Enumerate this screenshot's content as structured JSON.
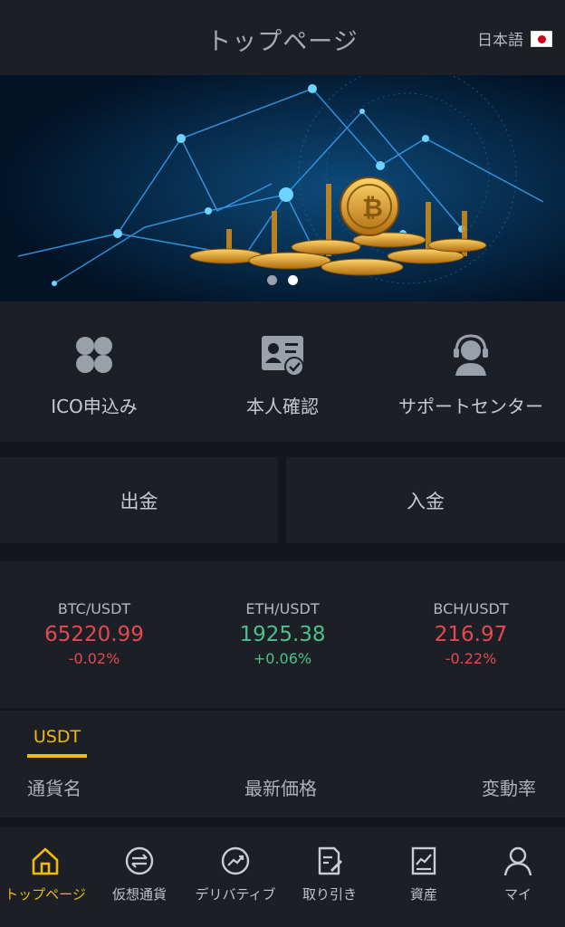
{
  "header": {
    "title": "トップページ",
    "language": "日本語",
    "flag_icon": "japan-flag-icon"
  },
  "banner": {
    "slide_count": 2,
    "active_slide": 2
  },
  "quick_actions": [
    {
      "label": "ICO申込み",
      "icon": "clover-icon"
    },
    {
      "label": "本人確認",
      "icon": "id-card-check-icon"
    },
    {
      "label": "サポートセンター",
      "icon": "headset-agent-icon"
    }
  ],
  "funds": {
    "withdraw_label": "出金",
    "deposit_label": "入金"
  },
  "tickers": [
    {
      "pair": "BTC/USDT",
      "price": "65220.99",
      "change": "-0.02%",
      "direction": "down"
    },
    {
      "pair": "ETH/USDT",
      "price": "1925.38",
      "change": "+0.06%",
      "direction": "up"
    },
    {
      "pair": "BCH/USDT",
      "price": "216.97",
      "change": "-0.22%",
      "direction": "down"
    }
  ],
  "market": {
    "active_tab": "USDT",
    "columns": {
      "name": "通貨名",
      "price": "最新価格",
      "change": "変動率"
    }
  },
  "bottom_nav": [
    {
      "label": "トップページ",
      "icon": "home-icon",
      "active": true
    },
    {
      "label": "仮想通貨",
      "icon": "exchange-arrows-icon",
      "active": false
    },
    {
      "label": "デリバティブ",
      "icon": "trend-chart-icon",
      "active": false
    },
    {
      "label": "取り引き",
      "icon": "document-edit-icon",
      "active": false
    },
    {
      "label": "資産",
      "icon": "asset-chart-icon",
      "active": false
    },
    {
      "label": "マイ",
      "icon": "user-icon",
      "active": false
    }
  ],
  "colors": {
    "accent": "#f0b90b",
    "down": "#e5484d",
    "up": "#4bc08a",
    "panel": "#1c1f26",
    "background": "#14161c"
  }
}
